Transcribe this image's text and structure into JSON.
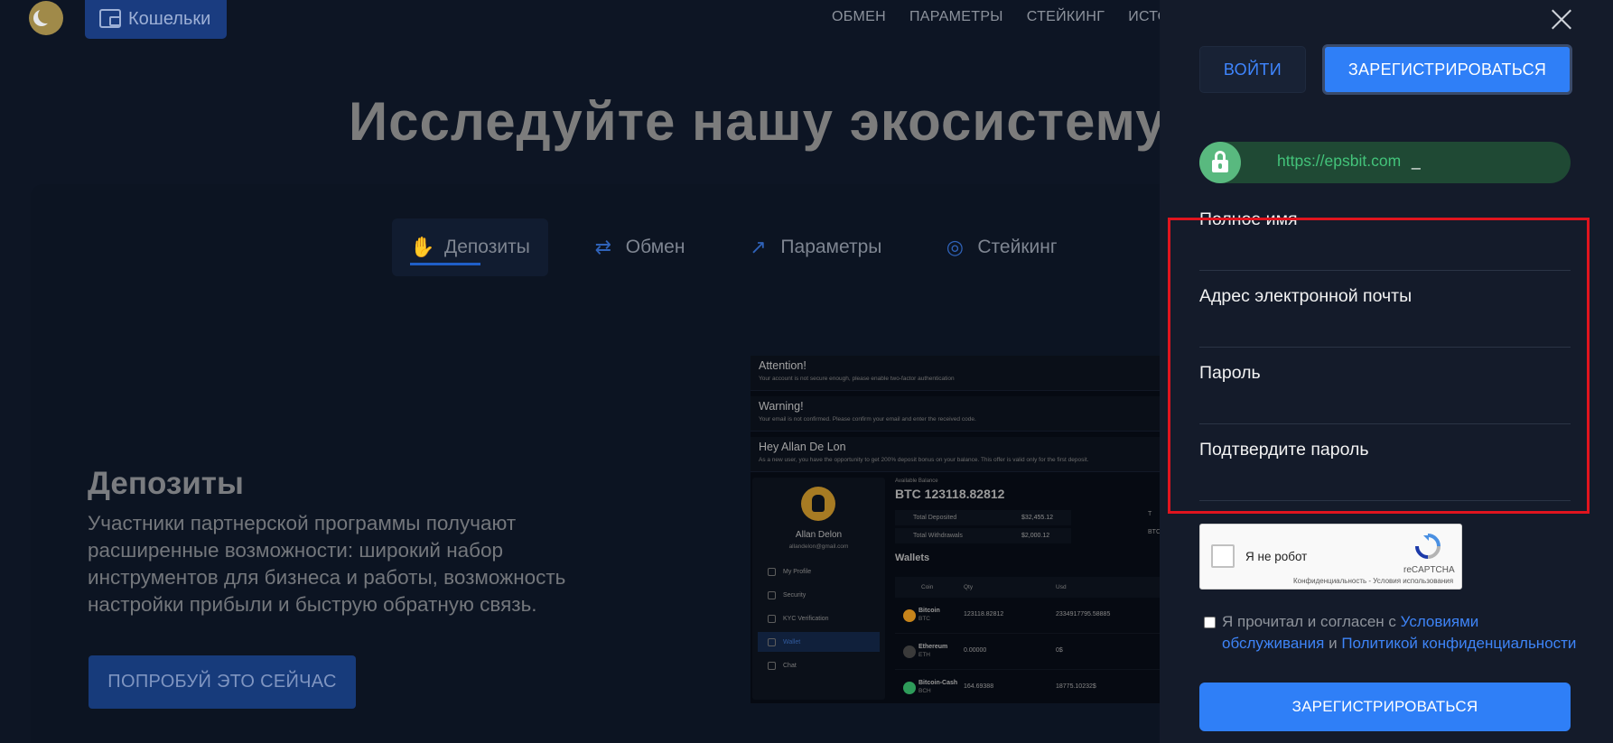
{
  "header": {
    "wallet_label": "Кошельки",
    "nav": [
      "ОБМЕН",
      "ПАРАМЕТРЫ",
      "СТЕЙКИНГ",
      "ИСТО"
    ]
  },
  "hero": {
    "title": "Исследуйте нашу экосистему"
  },
  "tabs": [
    {
      "label": "Депозиты",
      "icon": "hand-coin-icon",
      "active": true
    },
    {
      "label": "Обмен",
      "icon": "swap-arrows-icon",
      "active": false
    },
    {
      "label": "Параметры",
      "icon": "trend-chart-icon",
      "active": false
    },
    {
      "label": "Стейкинг",
      "icon": "coin-stack-icon",
      "active": false
    }
  ],
  "section": {
    "title": "Депозиты",
    "text": "Участники партнерской программы получают расширенные возможности: широкий набор инструментов для бизнеса и работы, возможность настройки прибыли и быструю обратную связь.",
    "cta": "ПОПРОБУЙ ЭТО СЕЙЧАС"
  },
  "dashboard": {
    "alerts": [
      {
        "title": "Attention!",
        "text": "Your account is not secure enough, please enable two-factor authentication"
      },
      {
        "title": "Warning!",
        "text": "Your email is not confirmed. Please confirm your email and enter the received code."
      },
      {
        "title": "Hey Allan De Lon",
        "text": "As a new user, you have the opportunity to get 200% deposit bonus on your balance. This offer is valid only for the first deposit."
      }
    ],
    "profile": {
      "name": "Allan Delon",
      "email": "allandelon@gmail.com",
      "menu": [
        "My Profile",
        "Security",
        "KYC Verification",
        "Wallet",
        "Chat"
      ]
    },
    "balance_label": "Available Balance",
    "balance": "BTC 123118.82812",
    "stats": [
      {
        "label": "Total Deposited",
        "value": "$32,455.12"
      },
      {
        "label": "Total Withdrawals",
        "value": "$2,000.12"
      }
    ],
    "side_labels": [
      "T",
      "BTC"
    ],
    "wallets_title": "Wallets",
    "wallet_columns": [
      "Coin",
      "Qty",
      "Usd"
    ],
    "wallet_rows": [
      {
        "coin": "Bitcoin",
        "ticker": "BTC",
        "qty": "123118.82812",
        "usd": "2334917795.58885",
        "color": "#c7841b"
      },
      {
        "coin": "Ethereum",
        "ticker": "ETH",
        "qty": "0.00000",
        "usd": "0$",
        "color": "#6c6c6c"
      },
      {
        "coin": "Bitcoin-Cash",
        "ticker": "BCH",
        "qty": "164.69388",
        "usd": "18775.10232$",
        "color": "#2e9c5a"
      }
    ]
  },
  "drawer": {
    "login": "ВОЙТИ",
    "register_top": "ЗАРЕГИСТРИРОВАТЬСЯ",
    "url": "https://epsbit.com",
    "url_cursor": "_",
    "fields": [
      "Полное имя",
      "Адрес электронной почты",
      "Пароль",
      "Подтвердите пароль"
    ],
    "captcha": {
      "text": "Я не робот",
      "brand": "reCAPTCHA",
      "links": "Конфиденциальность - Условия использования"
    },
    "agree": {
      "prefix": "Я прочитал и согласен с ",
      "terms": "Условиями обслуживания",
      "and": " и ",
      "privacy": "Политикой конфиденциальности"
    },
    "register": "ЗАРЕГИСТРИРОВАТЬСЯ"
  },
  "colors": {
    "accent": "#2f7ff7",
    "drawer_bg": "#141b2a",
    "highlight": "#e0141e",
    "url_green": "#43c37a"
  }
}
